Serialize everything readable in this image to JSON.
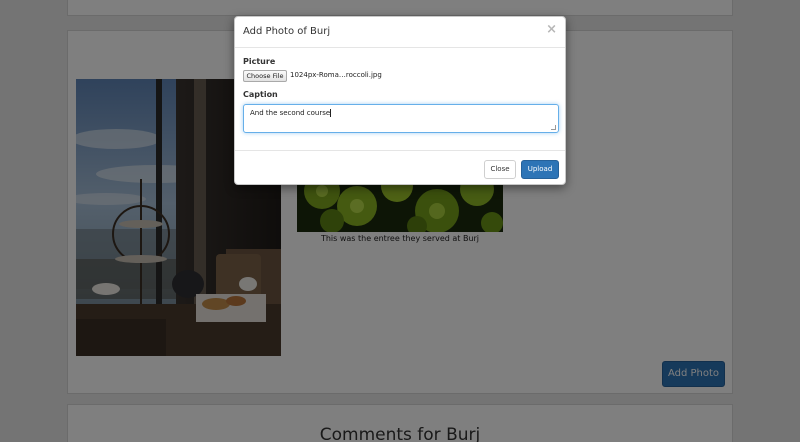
{
  "page": {
    "photo_caption": "This was the entree they served at Burj",
    "add_photo_label": "Add Photo",
    "comments_title": "Comments for Burj"
  },
  "modal": {
    "title": "Add Photo of Burj",
    "close_glyph": "×",
    "picture_label": "Picture",
    "choose_file_label": "Choose File",
    "file_name": "1024px-Roma…roccoli.jpg",
    "caption_label": "Caption",
    "caption_value": "And the second course",
    "close_button": "Close",
    "upload_button": "Upload"
  },
  "colors": {
    "primary": "#2d74b6",
    "backdrop": "rgba(0,0,0,0.5)",
    "focus_border": "#66afe9"
  }
}
